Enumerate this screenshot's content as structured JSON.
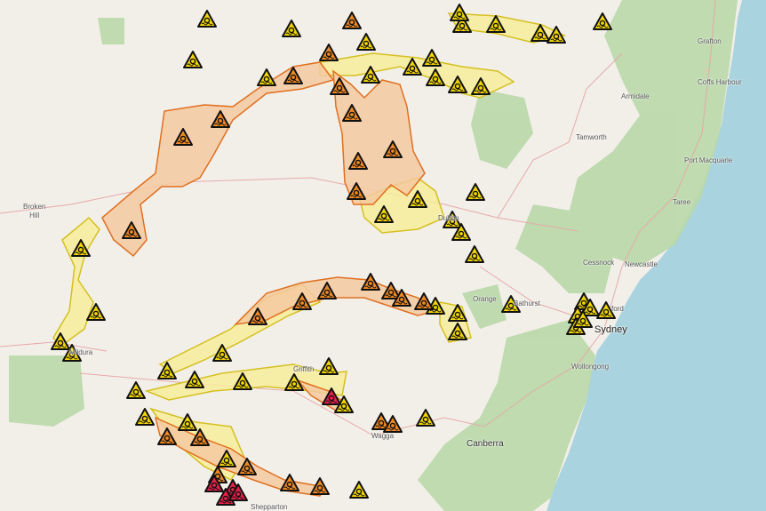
{
  "colors": {
    "land": "#f2efe9",
    "sea": "#a9d3df",
    "forest": "#add19e",
    "road": "#e6a0a0",
    "warning_fill": "#f5d9a8",
    "warning_stroke": "#e07020",
    "watch_fill": "#f7ec9a",
    "watch_stroke": "#d4c020",
    "advice_icon": "#f2d600",
    "watch_icon": "#f08a24",
    "emergency_icon": "#e8204a"
  },
  "places": [
    {
      "id": "broken-hill",
      "label": "Broken\nHill"
    },
    {
      "id": "mildura",
      "label": "Mildura"
    },
    {
      "id": "griffith",
      "label": "Griffith"
    },
    {
      "id": "wagga",
      "label": "Wagga"
    },
    {
      "id": "canberra",
      "label": "Canberra"
    },
    {
      "id": "orange",
      "label": "Orange"
    },
    {
      "id": "bathurst",
      "label": "Bathurst"
    },
    {
      "id": "dubbo",
      "label": "Dubbo"
    },
    {
      "id": "tamworth",
      "label": "Tamworth"
    },
    {
      "id": "armidale",
      "label": "Armidale"
    },
    {
      "id": "grafton",
      "label": "Grafton"
    },
    {
      "id": "coffs-harbour",
      "label": "Coffs Harbour"
    },
    {
      "id": "port-macquarie",
      "label": "Port Macquarie"
    },
    {
      "id": "taree",
      "label": "Taree"
    },
    {
      "id": "cessnock",
      "label": "Cessnock"
    },
    {
      "id": "newcastle",
      "label": "Newcastle"
    },
    {
      "id": "gosford",
      "label": "Gosford"
    },
    {
      "id": "sydney",
      "label": "Sydney"
    },
    {
      "id": "wollongong",
      "label": "Wollongong"
    },
    {
      "id": "shepparton",
      "label": "Shepparton"
    }
  ],
  "markers": {
    "advice_count": 58,
    "watch_count": 22,
    "emergency_count": 5
  }
}
